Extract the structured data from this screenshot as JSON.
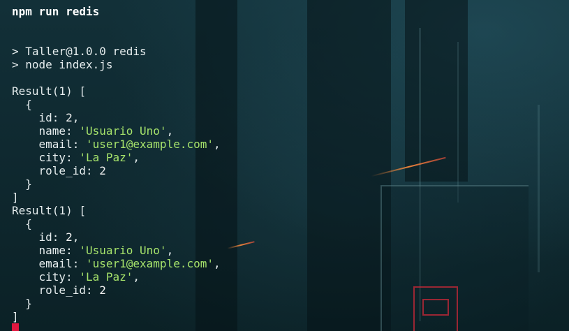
{
  "terminal": {
    "command": "npm run redis",
    "script_line_1": "> Taller@1.0.0 redis",
    "script_line_2": "> node index.js",
    "results": [
      {
        "header": "Result(1) [",
        "open_brace": "{",
        "id_key": "id: ",
        "id_value": "2",
        "id_comma": ",",
        "name_key": "name: ",
        "name_value": "'Usuario Uno'",
        "name_comma": ",",
        "email_key": "email: ",
        "email_value": "'user1@example.com'",
        "email_comma": ",",
        "city_key": "city: ",
        "city_value": "'La Paz'",
        "city_comma": ",",
        "role_key": "role_id: ",
        "role_value": "2",
        "close_brace": "}",
        "close_bracket": "]"
      },
      {
        "header": "Result(1) [",
        "open_brace": "{",
        "id_key": "id: ",
        "id_value": "2",
        "id_comma": ",",
        "name_key": "name: ",
        "name_value": "'Usuario Uno'",
        "name_comma": ",",
        "email_key": "email: ",
        "email_value": "'user1@example.com'",
        "email_comma": ",",
        "city_key": "city: ",
        "city_value": "'La Paz'",
        "city_comma": ",",
        "role_key": "role_id: ",
        "role_value": "2",
        "close_brace": "}",
        "close_bracket": "]"
      }
    ]
  },
  "colors": {
    "background": "#0f2a30",
    "text": "#e6edee",
    "string": "#a6e36b",
    "cursor": "#e0173f"
  }
}
